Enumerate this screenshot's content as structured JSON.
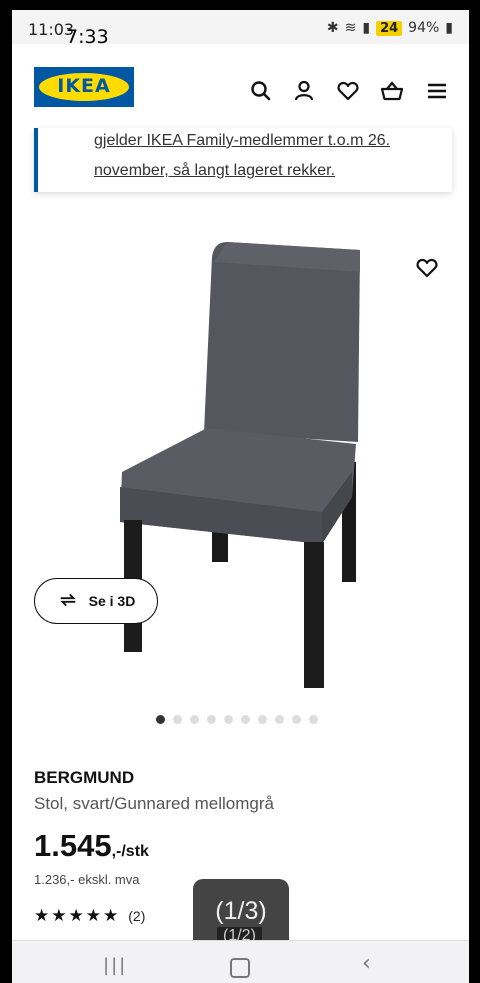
{
  "status_bar": {
    "time": "11:03",
    "time_overlay": "7:33",
    "battery_text": "94%",
    "badge": "24"
  },
  "header": {
    "logo_text": "IKEA",
    "icons": [
      "search-icon",
      "user-icon",
      "heart-icon",
      "cart-icon",
      "menu-icon"
    ]
  },
  "banner": {
    "text": "gjelder IKEA Family-medlemmer t.o.m 26. november, så langt lageret rekker."
  },
  "gallery": {
    "button_3d_label": "Se i 3D",
    "dot_count": 10,
    "active_dot": 0
  },
  "product": {
    "name": "BERGMUND",
    "description": "Stol, svart/Gunnared mellomgrå",
    "price": "1.545",
    "price_unit": ",-/stk",
    "price_ex_vat": "1.236,- ekskl. mva",
    "rating_stars": 5,
    "rating_count": "(2)"
  },
  "overlay": {
    "main": "(1/3)",
    "sub": "(1/2)"
  },
  "colors": {
    "ikea_blue": "#0058a3",
    "ikea_yellow": "#ffdb00"
  }
}
